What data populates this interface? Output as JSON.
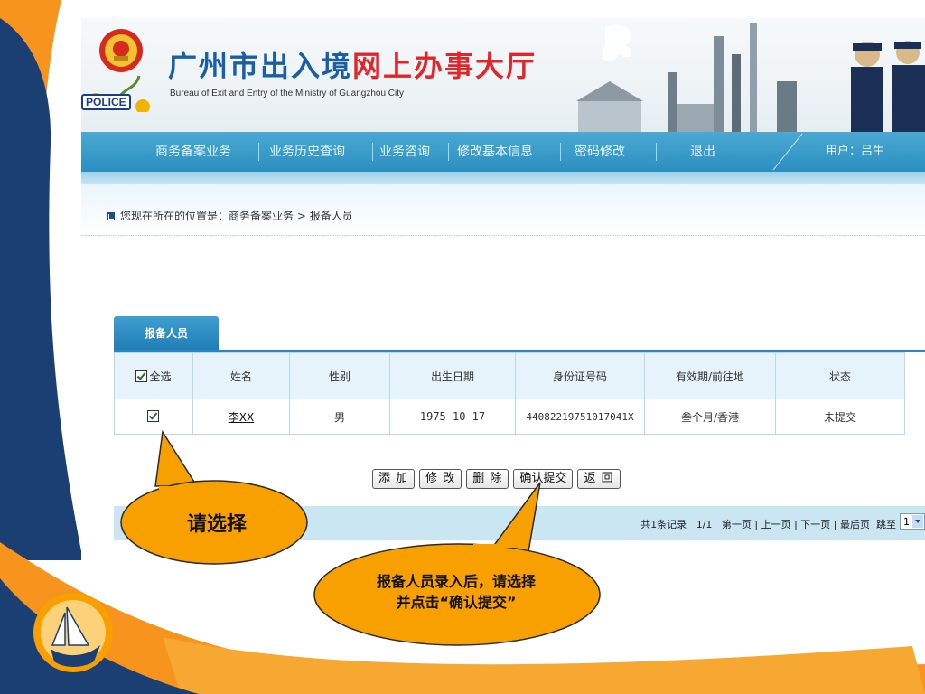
{
  "header": {
    "title_blue": "广州市出入境",
    "title_red": "网上办事大厅",
    "subtitle": "Bureau of Exit and Entry of the Ministry of Guangzhou City",
    "badge": "POLICE"
  },
  "nav": {
    "items": [
      "商务备案业务",
      "业务历史查询",
      "业务咨询",
      "修改基本信息",
      "密码修改",
      "退出"
    ],
    "user_label": "用户：",
    "user_name": "吕生"
  },
  "breadcrumb": {
    "prefix": "您现在所在的位置是：",
    "path": "商务备案业务 > 报备人员"
  },
  "tab": {
    "label": "报备人员"
  },
  "table": {
    "select_all_label": "全选",
    "columns": [
      "姓名",
      "性别",
      "出生日期",
      "身份证号码",
      "有效期/前往地",
      "状态"
    ],
    "rows": [
      {
        "checked": true,
        "name": "李XX",
        "gender": "男",
        "birthdate": "1975-10-17",
        "id_number": "44082219751017041X",
        "validity_destination": "叁个月/香港",
        "status": "未提交"
      }
    ]
  },
  "buttons": {
    "add": "添 加",
    "edit": "修 改",
    "delete": "删 除",
    "confirm": "确认提交",
    "back": "返 回"
  },
  "pager": {
    "summary": "共1条记录",
    "page_info": "1/1",
    "first": "第一页",
    "prev": "上一页",
    "next": "下一页",
    "last": "最后页",
    "jump": "跳至",
    "current_page": "1"
  },
  "callouts": {
    "select": "请选择",
    "confirm_line1": "报备人员录入后，请选择",
    "confirm_line2": "并点击“确认提交”"
  },
  "colors": {
    "nav_blue": "#2b8fc0",
    "title_blue": "#1a5fa6",
    "title_red": "#e0262a",
    "callout_fill": "#f7a000",
    "slide_orange": "#f7941d",
    "slide_navy": "#1b3f73"
  }
}
